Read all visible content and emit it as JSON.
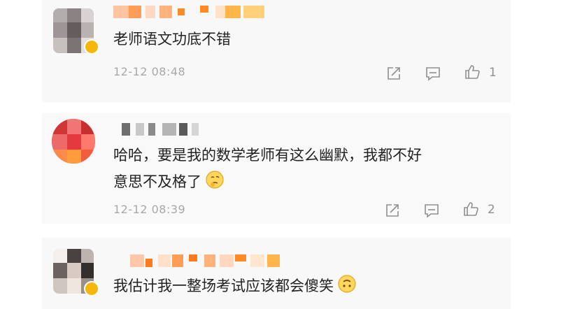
{
  "comments": [
    {
      "text_lines": [
        "老师语文功底不错"
      ],
      "time": "12-12 08:48",
      "like_count": "1"
    },
    {
      "text_lines": [
        "哈哈，要是我的数学老师有这么幽默，我都不好",
        "意思不及格了"
      ],
      "time": "12-12 08:39",
      "like_count": "2"
    },
    {
      "text_lines": [
        "我估计我一整场考试应该都会傻笑"
      ]
    }
  ],
  "icons": {
    "share": "share-icon",
    "comment": "comment-icon",
    "like": "thumbs-up-icon"
  },
  "colors": {
    "text": "#222222",
    "meta": "#a8a8a8",
    "icon": "#8f8f8f",
    "badge_gold": "#f5b80a",
    "blur_orange": "#ff8a24"
  }
}
